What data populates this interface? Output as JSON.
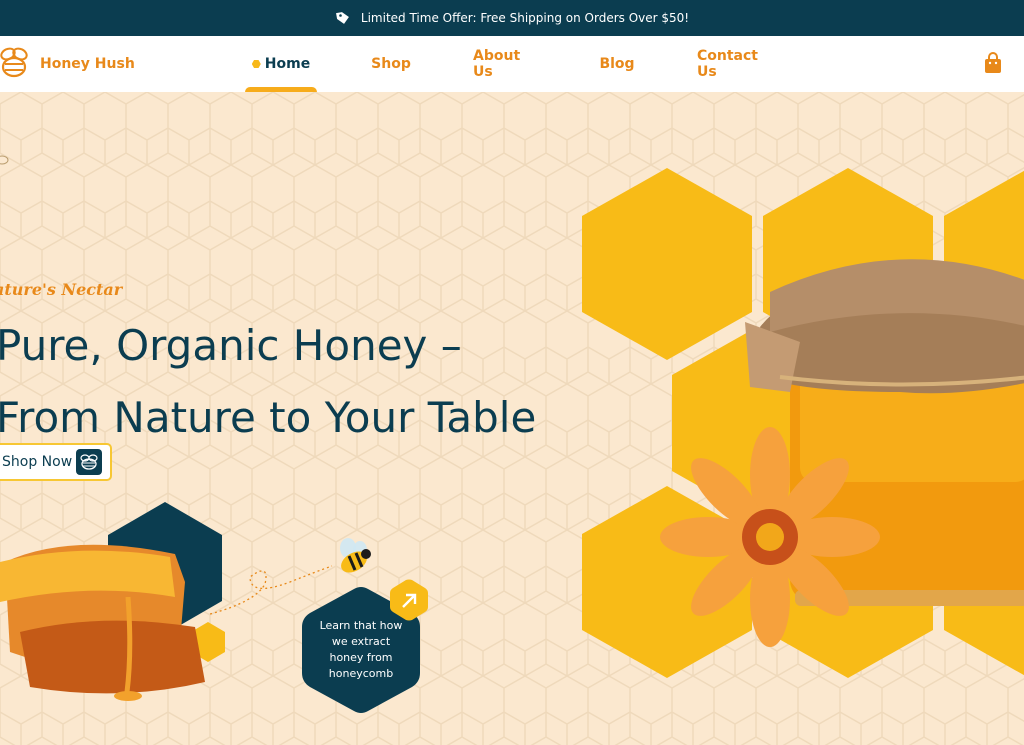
{
  "announcement": {
    "text": "Limited Time Offer: Free Shipping on Orders Over $50!",
    "icon": "tag-icon"
  },
  "brand": {
    "name": "Honey Hush",
    "logo_icon": "bee-logo-icon",
    "color": "#e8891a"
  },
  "nav": {
    "items": [
      {
        "label": "Home",
        "active": true
      },
      {
        "label": "Shop",
        "active": false
      },
      {
        "label": "About Us",
        "active": false
      },
      {
        "label": "Blog",
        "active": false
      },
      {
        "label": "Contact Us",
        "active": false
      }
    ]
  },
  "header_actions": {
    "cart_icon": "shopping-bag-icon"
  },
  "hero": {
    "eyebrow": "ature's Nectar",
    "headline_line1": "Pure, Organic Honey –",
    "headline_line2": "From Nature to Your Table",
    "cta_label": "Shop Now",
    "learn_text": "Learn that how we extract honey from honeycomb",
    "learn_icon": "arrow-up-right-icon"
  },
  "colors": {
    "navy": "#0b3d50",
    "accent_orange": "#e8891a",
    "honey_yellow": "#f7b81a",
    "background": "#fbe8cf"
  }
}
